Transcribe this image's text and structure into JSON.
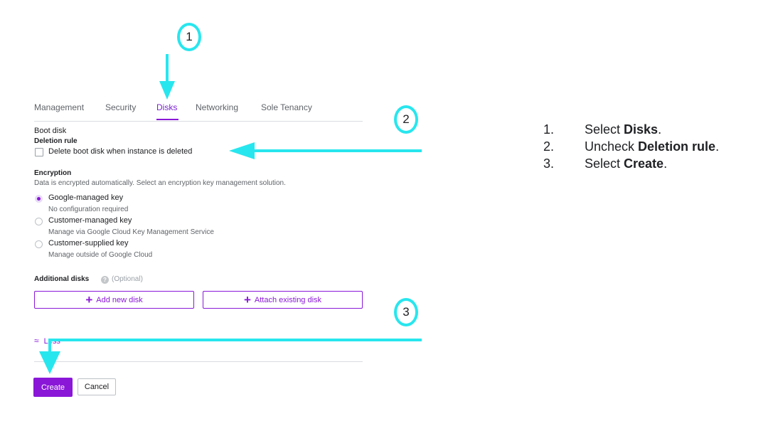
{
  "tabs": [
    {
      "label": "Management",
      "active": false
    },
    {
      "label": "Security",
      "active": false
    },
    {
      "label": "Disks",
      "active": true
    },
    {
      "label": "Networking",
      "active": false
    },
    {
      "label": "Sole Tenancy",
      "active": false
    }
  ],
  "boot_disk": {
    "title": "Boot disk",
    "deletion_rule_label": "Deletion rule",
    "delete_checkbox_label": "Delete boot disk when instance is deleted",
    "delete_checked": false
  },
  "encryption": {
    "title": "Encryption",
    "description": "Data is encrypted automatically. Select an encryption key management solution.",
    "options": [
      {
        "label": "Google-managed key",
        "sub": "No configuration required",
        "selected": true
      },
      {
        "label": "Customer-managed key",
        "sub": "Manage via Google Cloud Key Management Service",
        "selected": false
      },
      {
        "label": "Customer-supplied key",
        "sub": "Manage outside of Google Cloud",
        "selected": false
      }
    ]
  },
  "additional_disks": {
    "title": "Additional disks",
    "help_glyph": "?",
    "optional_label": "(Optional)",
    "add_new_label": "Add new disk",
    "attach_existing_label": "Attach existing disk"
  },
  "less_label": "Less",
  "less_glyph": "≈",
  "actions": {
    "create_label": "Create",
    "cancel_label": "Cancel"
  },
  "callouts": [
    "1",
    "2",
    "3"
  ],
  "instructions": [
    {
      "num": "1.",
      "prefix": "Select ",
      "bold": "Disks",
      "suffix": "."
    },
    {
      "num": "2.",
      "prefix": "Uncheck ",
      "bold": "Deletion rule",
      "suffix": "."
    },
    {
      "num": "3.",
      "prefix": "Select ",
      "bold": "Create",
      "suffix": "."
    }
  ],
  "colors": {
    "accent": "#8a17d8",
    "callout": "#28e6ee",
    "arrow": "#28e6ee"
  }
}
